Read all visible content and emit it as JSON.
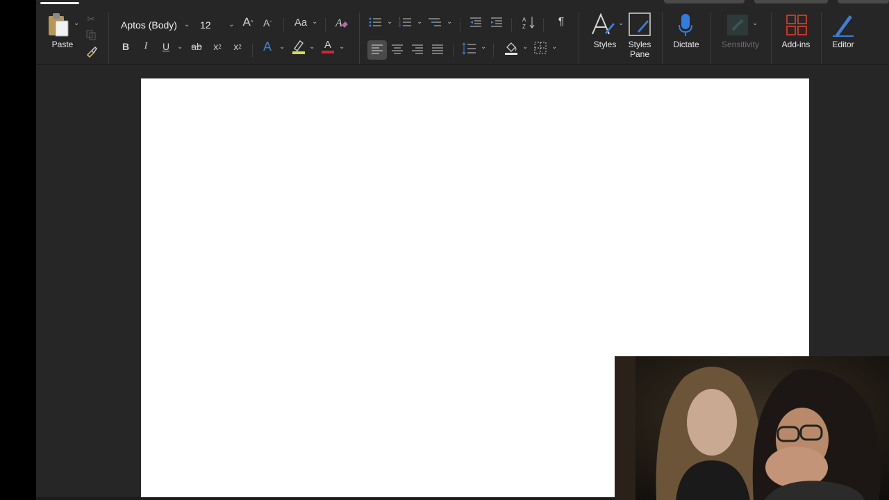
{
  "ribbon": {
    "clipboard": {
      "paste_label": "Paste"
    },
    "font": {
      "name": "Aptos (Body)",
      "size": "12"
    },
    "buttons": {
      "bold": "B",
      "italic": "I",
      "underline": "U",
      "strike": "ab",
      "subscript_base": "x",
      "subscript_mark": "2",
      "superscript_base": "x",
      "superscript_mark": "2",
      "change_case": "Aa",
      "grow_a": "A",
      "shrink_a": "A",
      "text_effects_a": "A",
      "font_color_a": "A",
      "show_marks": "¶"
    },
    "styles_label": "Styles",
    "styles_pane_label_1": "Styles",
    "styles_pane_label_2": "Pane",
    "dictate_label": "Dictate",
    "sensitivity_label": "Sensitivity",
    "addins_label": "Add-ins",
    "editor_label": "Editor"
  },
  "colors": {
    "highlight": "#d6e14a",
    "font_color": "#e0202a",
    "text_effects": "#3b82d6",
    "dictate": "#2f7de1",
    "addins": "#c0392b",
    "editor": "#3b7fd6"
  }
}
